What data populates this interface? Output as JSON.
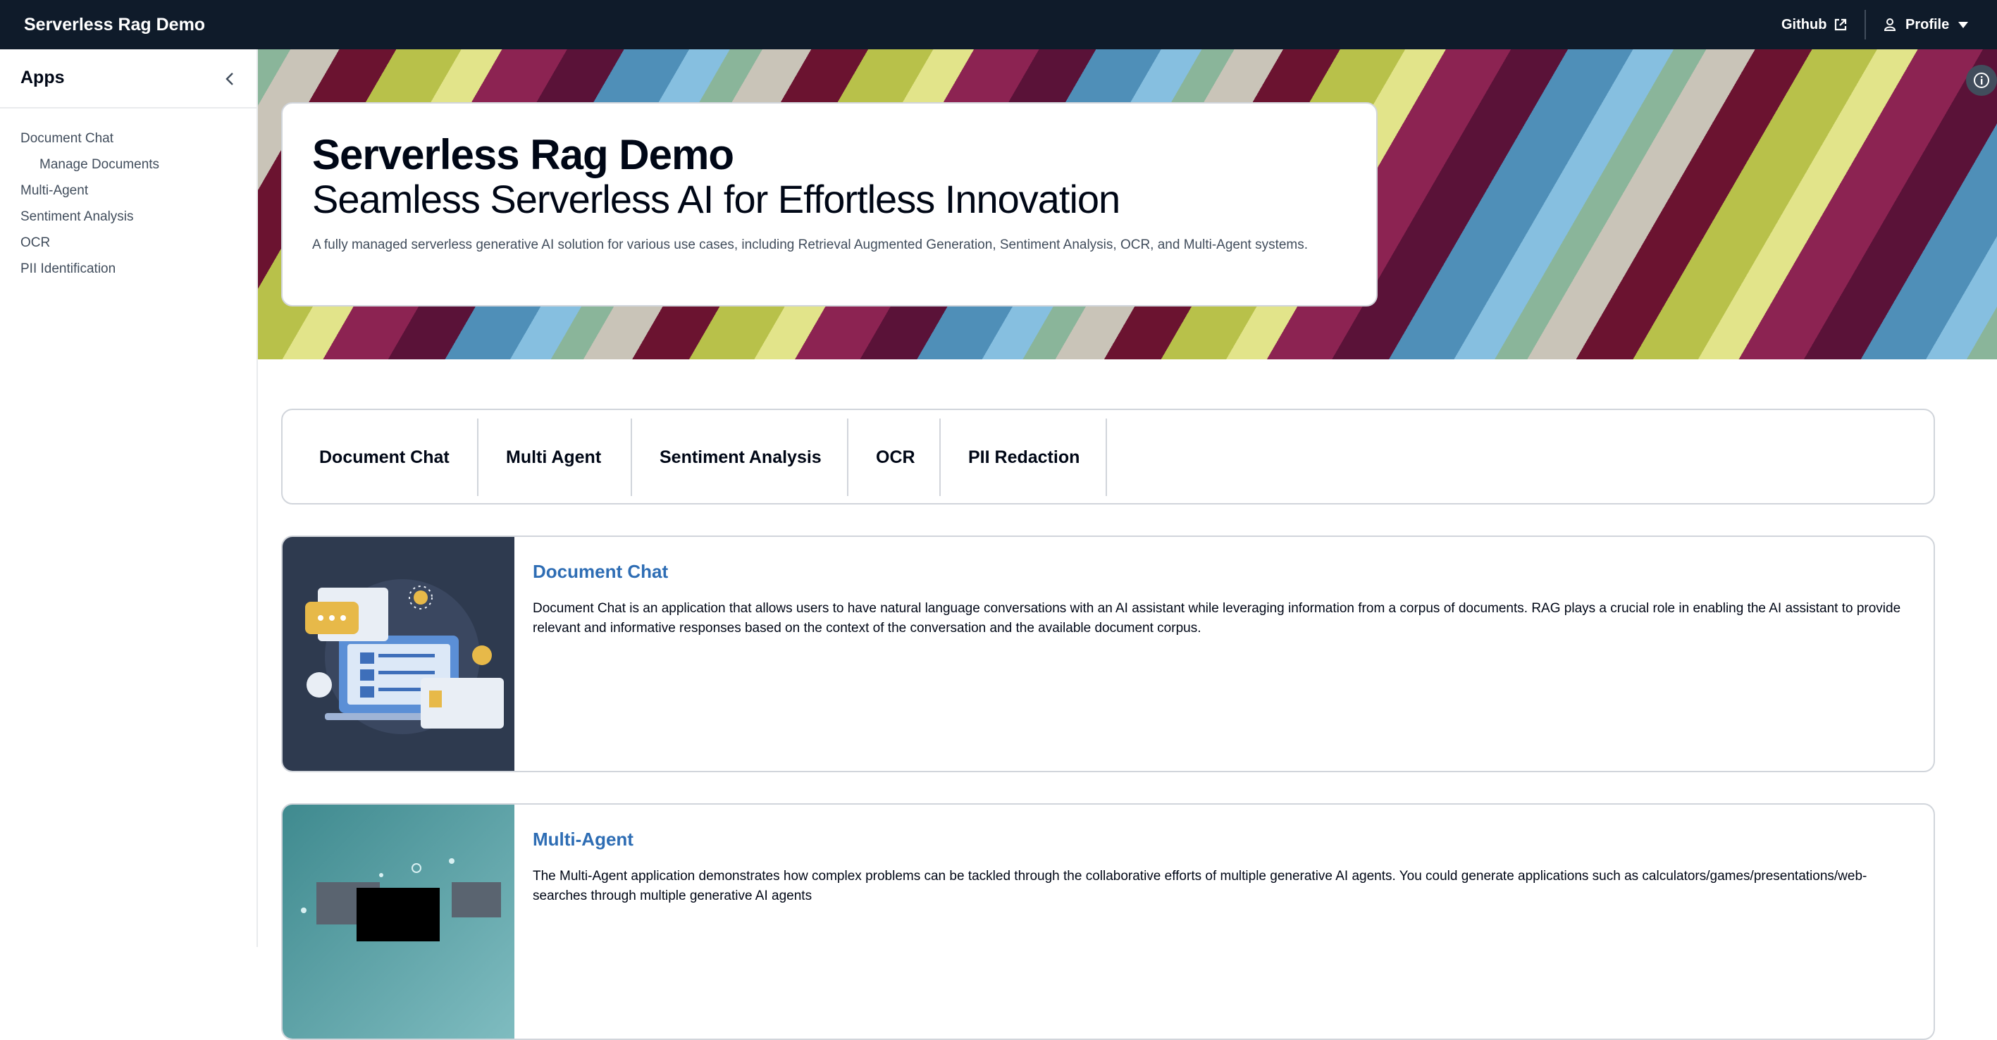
{
  "topbar": {
    "brand": "Serverless Rag Demo",
    "github_label": "Github",
    "profile_label": "Profile"
  },
  "sidebar": {
    "title": "Apps",
    "items": [
      {
        "label": "Document Chat",
        "child": false
      },
      {
        "label": "Manage Documents",
        "child": true
      },
      {
        "label": "Multi-Agent",
        "child": false
      },
      {
        "label": "Sentiment Analysis",
        "child": false
      },
      {
        "label": "OCR",
        "child": false
      },
      {
        "label": "PII Identification",
        "child": false
      }
    ]
  },
  "hero": {
    "title": "Serverless Rag Demo",
    "subtitle": "Seamless Serverless AI for Effortless Innovation",
    "description": "A fully managed serverless generative AI solution for various use cases, including Retrieval Augmented Generation, Sentiment Analysis, OCR, and Multi-Agent systems."
  },
  "tabs": [
    {
      "label": "Document Chat"
    },
    {
      "label": "Multi Agent"
    },
    {
      "label": "Sentiment Analysis"
    },
    {
      "label": "OCR"
    },
    {
      "label": "PII Redaction"
    }
  ],
  "cards": [
    {
      "title": "Document Chat",
      "description": "Document Chat is an application that allows users to have natural language conversations with an AI assistant while leveraging information from a corpus of documents. RAG plays a crucial role in enabling the AI assistant to provide relevant and informative responses based on the context of the conversation and the available document corpus."
    },
    {
      "title": "Multi-Agent",
      "description": "The Multi-Agent application demonstrates how complex problems can be tackled through the collaborative efforts of multiple generative AI agents. You could generate applications such as calculators/games/presentations/web-searches through multiple generative AI agents"
    }
  ],
  "colors": {
    "topbar_bg": "#0f1b2a",
    "link_blue": "#2e6db4",
    "border": "#d1d5db"
  },
  "icons": {
    "github_external": "external-link-icon",
    "profile": "user-icon",
    "profile_caret": "caret-down-icon",
    "sidebar_collapse": "chevron-left-icon",
    "hero_info": "info-icon"
  }
}
